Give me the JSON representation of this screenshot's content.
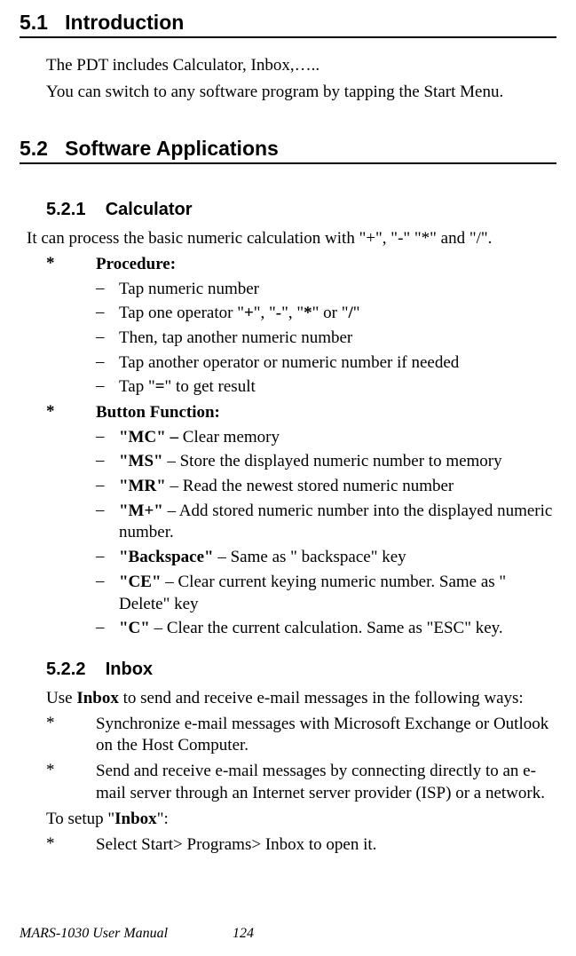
{
  "section51": {
    "num": "5.1",
    "title": "Introduction",
    "p1": "The PDT includes Calculator, Inbox,…..",
    "p2": "You can switch to any software program by tapping the Start Menu."
  },
  "section52": {
    "num": "5.2",
    "title": "Software Applications",
    "s521": {
      "num": "5.2.1",
      "title": "Calculator",
      "intro": " It can process the basic numeric calculation with \"+\", \"-\" \"*\" and \"/\".",
      "procLabel": "Procedure:",
      "procItems": [
        {
          "text": "Tap numeric number"
        },
        {
          "prefix": "Tap one operator \"",
          "b1": "+",
          "mid1": "\", \"",
          "b2": "-",
          "mid2": "\", \"",
          "b3": "*",
          "mid3": "\" or \"",
          "b4": "/",
          "suffix": "\""
        },
        {
          "text": "Then, tap another numeric number"
        },
        {
          "text": "Tap another operator or numeric number if needed"
        },
        {
          "prefix": "Tap \"",
          "b1": "=",
          "suffix": "\" to get result"
        }
      ],
      "btnLabel": "Button Function:",
      "btnItems": [
        {
          "b": "\"MC\" – ",
          "t": "Clear memory"
        },
        {
          "pre": " ",
          "b": "\"MS\"",
          "t": " – Store the displayed numeric number to memory"
        },
        {
          "b": "\"MR\"",
          "t": " – Read the newest stored numeric number"
        },
        {
          "b": "\"M+\"",
          "t": " – Add stored numeric number into the displayed numeric number."
        },
        {
          "b": "\"Backspace\"",
          "t": " – Same as \" backspace\" key"
        },
        {
          "b": "\"CE\"",
          "t": " – Clear current keying numeric number. Same as \" Delete\" key"
        },
        {
          "b": "\"C\"",
          "t": " – Clear the current calculation. Same as \"ESC\" key."
        }
      ]
    },
    "s522": {
      "num": "5.2.2",
      "title": "Inbox",
      "intro_pre": "Use ",
      "intro_b": "Inbox",
      "intro_post": " to send and receive e-mail messages in the following ways:",
      "items": [
        "Synchronize e-mail messages with Microsoft Exchange or Outlook on the Host Computer.",
        "Send and receive e-mail messages by connecting directly to an e-mail server through an Internet server provider (ISP) or a network."
      ],
      "setup_pre": "To setup \"",
      "setup_b": "Inbox",
      "setup_post": "\":",
      "setupItem": "Select Start> Programs> Inbox to open it."
    }
  },
  "footer": {
    "title": "MARS-1030 User Manual",
    "page": "124"
  },
  "star": "*",
  "dash": "–"
}
